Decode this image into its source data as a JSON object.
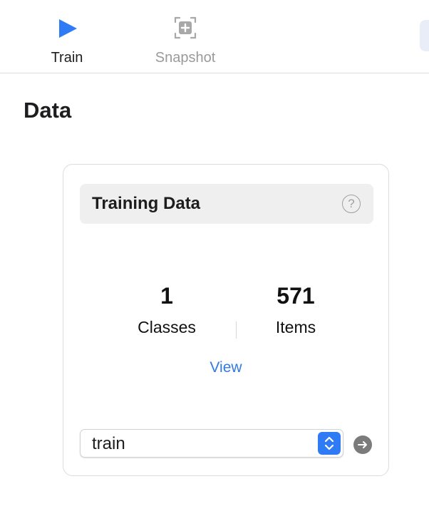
{
  "toolbar": {
    "items": [
      {
        "label": "Train",
        "icon": "play-icon",
        "selected": true,
        "color": "#2f7bf6"
      },
      {
        "label": "Snapshot",
        "icon": "snapshot-icon",
        "selected": false,
        "color": "#9a9a9a"
      }
    ]
  },
  "section": {
    "title": "Data"
  },
  "card": {
    "title": "Training Data",
    "help_icon": "?",
    "stats": {
      "classes": {
        "value": "1",
        "label": "Classes"
      },
      "items": {
        "value": "571",
        "label": "Items"
      }
    },
    "view_label": "View",
    "source_select": {
      "value": "train"
    },
    "go_icon": "arrow-right-circle-icon"
  }
}
